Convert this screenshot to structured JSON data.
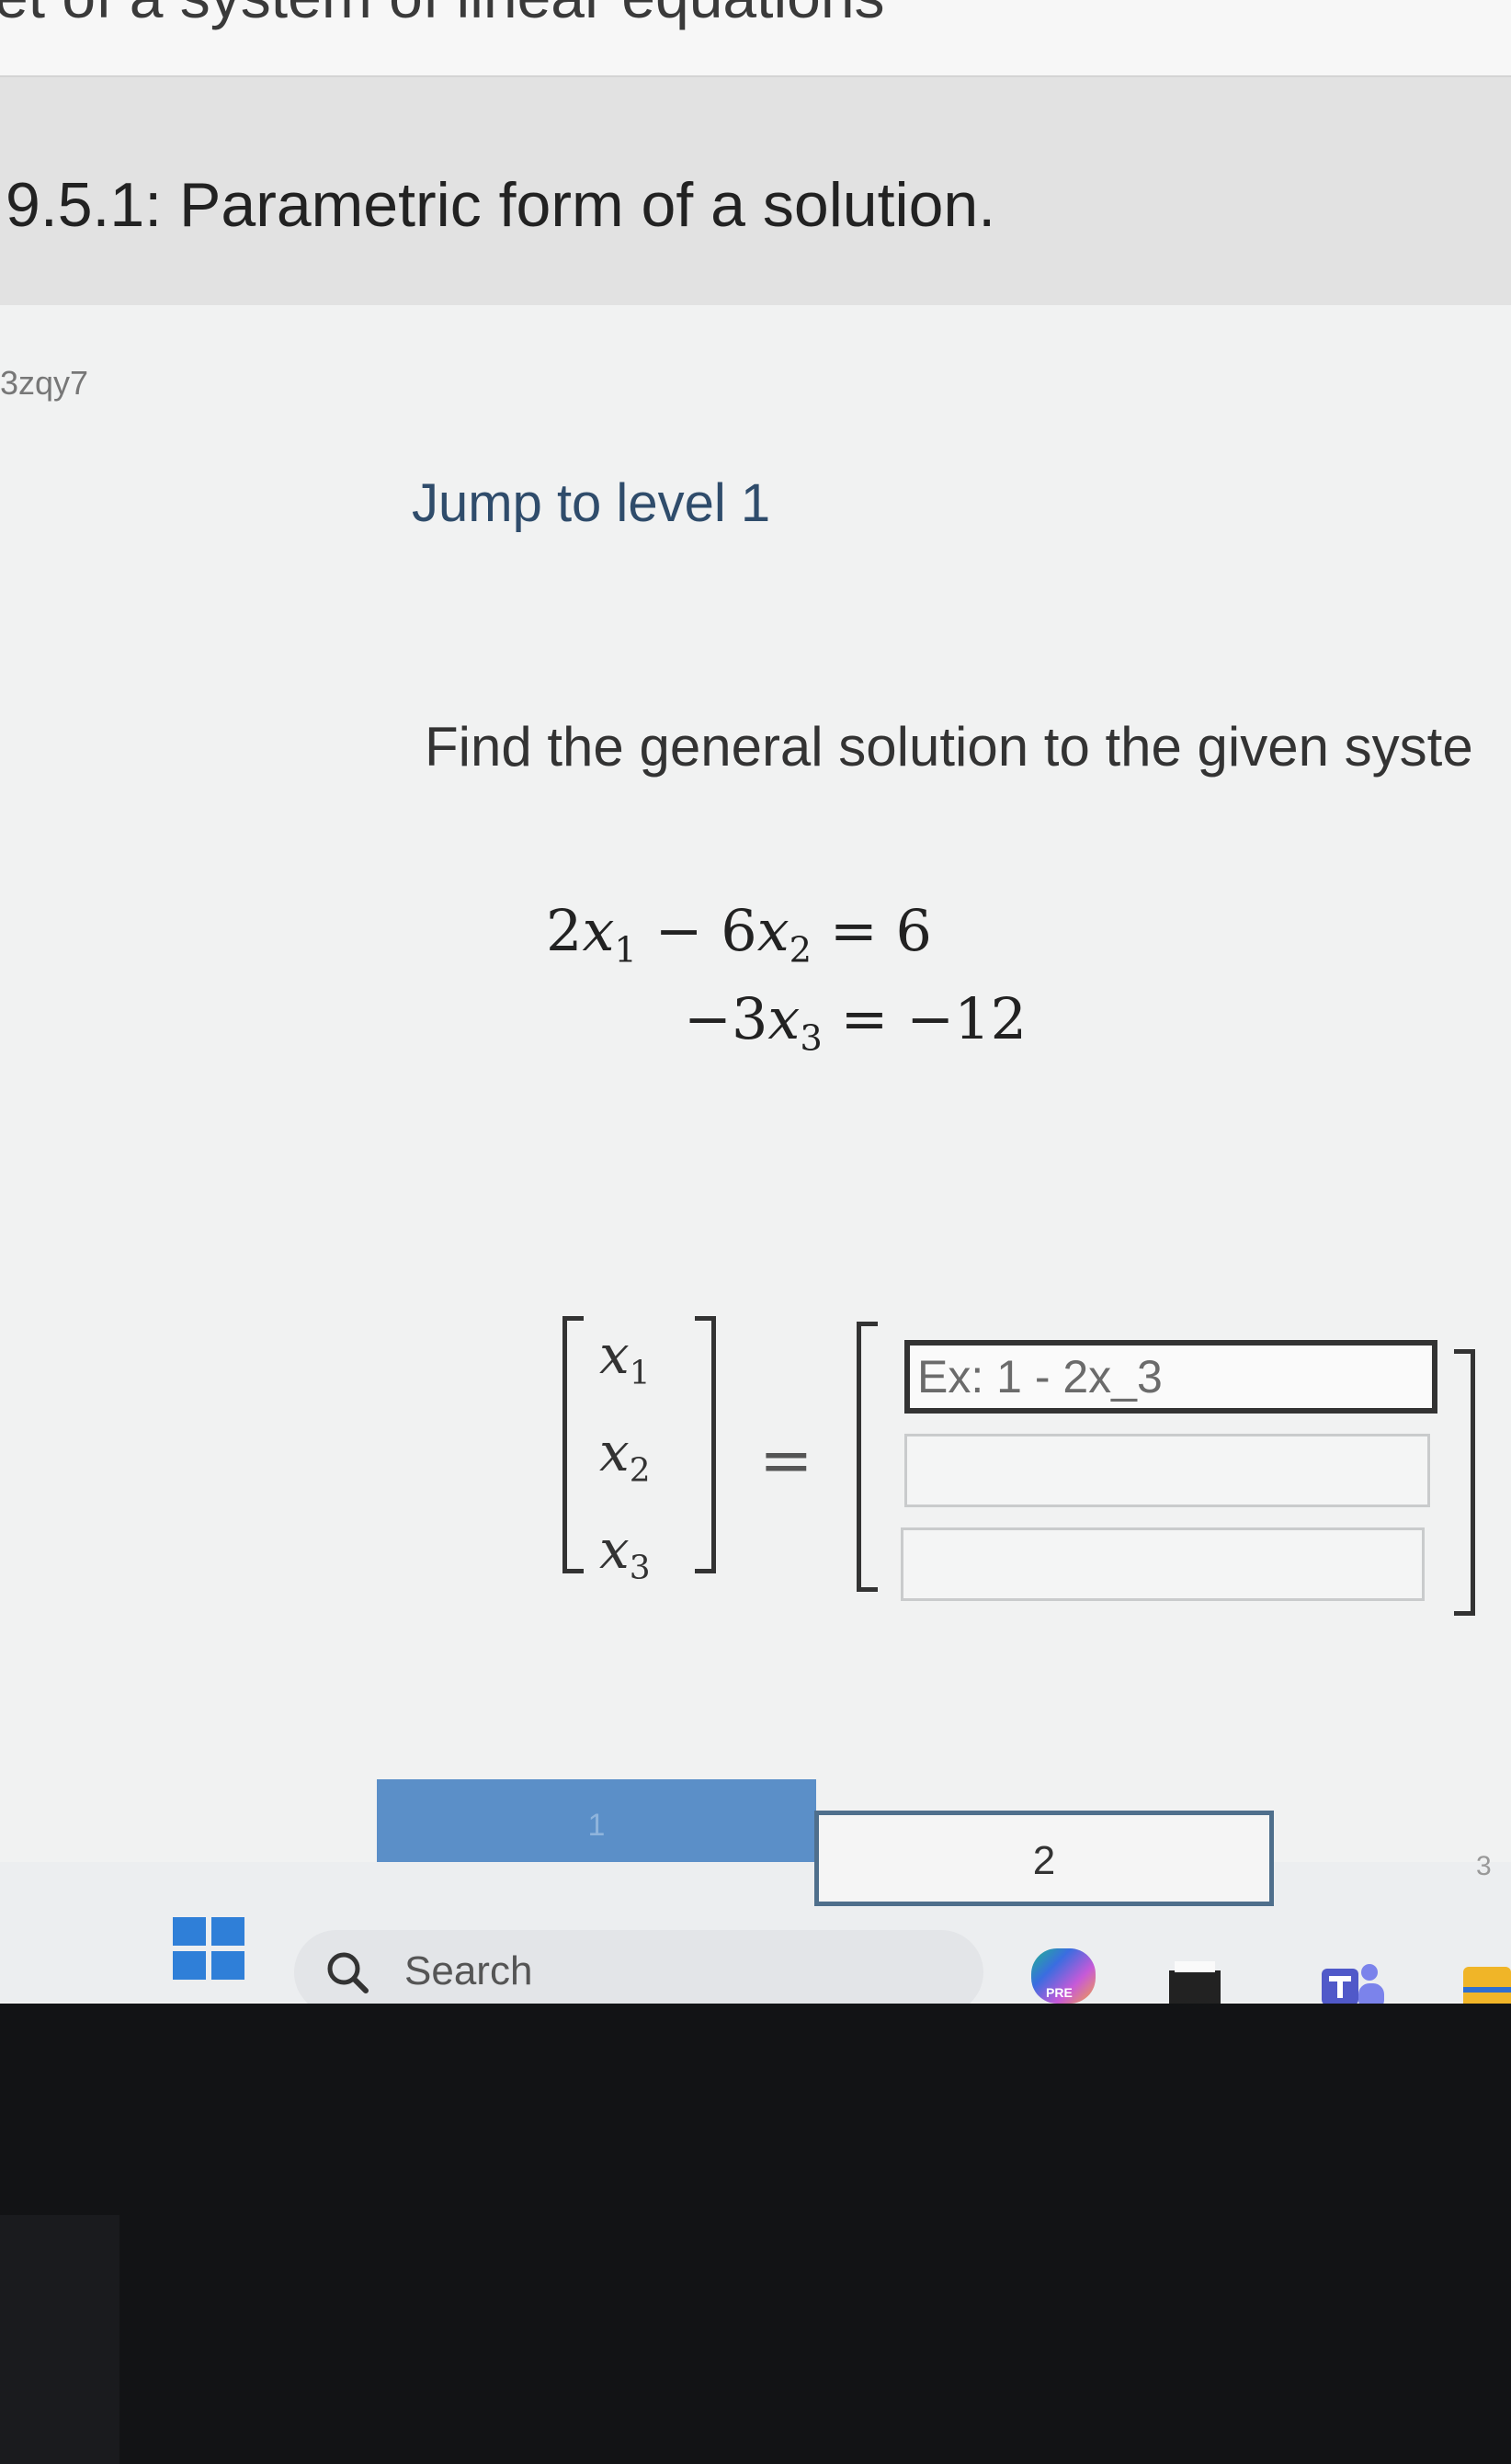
{
  "chapter": {
    "title": "et of a system of linear equations"
  },
  "section": {
    "title": "9.5.1: Parametric form of a solution."
  },
  "activity": {
    "id": "3zqy7"
  },
  "jump": {
    "label": "Jump to level 1"
  },
  "problem": {
    "prompt": "Find the general solution to the given syste",
    "equations": [
      {
        "lhs_parts": [
          "2",
          "x",
          "1",
          " − 6",
          "x",
          "2"
        ],
        "rhs": "6"
      },
      {
        "lhs_parts": [
          "−3",
          "x",
          "3"
        ],
        "rhs": "−12"
      }
    ]
  },
  "matrix": {
    "vars": [
      {
        "name": "x",
        "sub": "1"
      },
      {
        "name": "x",
        "sub": "2"
      },
      {
        "name": "x",
        "sub": "3"
      }
    ],
    "equals": "=",
    "inputs": [
      {
        "placeholder": "Ex: 1 - 2x_3",
        "value": ""
      },
      {
        "placeholder": "",
        "value": ""
      },
      {
        "placeholder": "",
        "value": ""
      }
    ]
  },
  "levels": [
    {
      "label": "1",
      "state": "completed"
    },
    {
      "label": "2",
      "state": "current"
    },
    {
      "label": "3",
      "state": "upcoming"
    }
  ],
  "taskbar": {
    "search_label": "Search",
    "icons": [
      "windows-start-icon",
      "search-icon",
      "copilot-icon",
      "microsoft-store-icon",
      "teams-icon",
      "file-explorer-icon"
    ],
    "copilot_badge": "PRE"
  },
  "colors": {
    "link": "#2f4c6b",
    "level_completed": "#5b8fc8",
    "level_current_border": "#4f6f8c",
    "start_blue": "#2f7fd8"
  }
}
